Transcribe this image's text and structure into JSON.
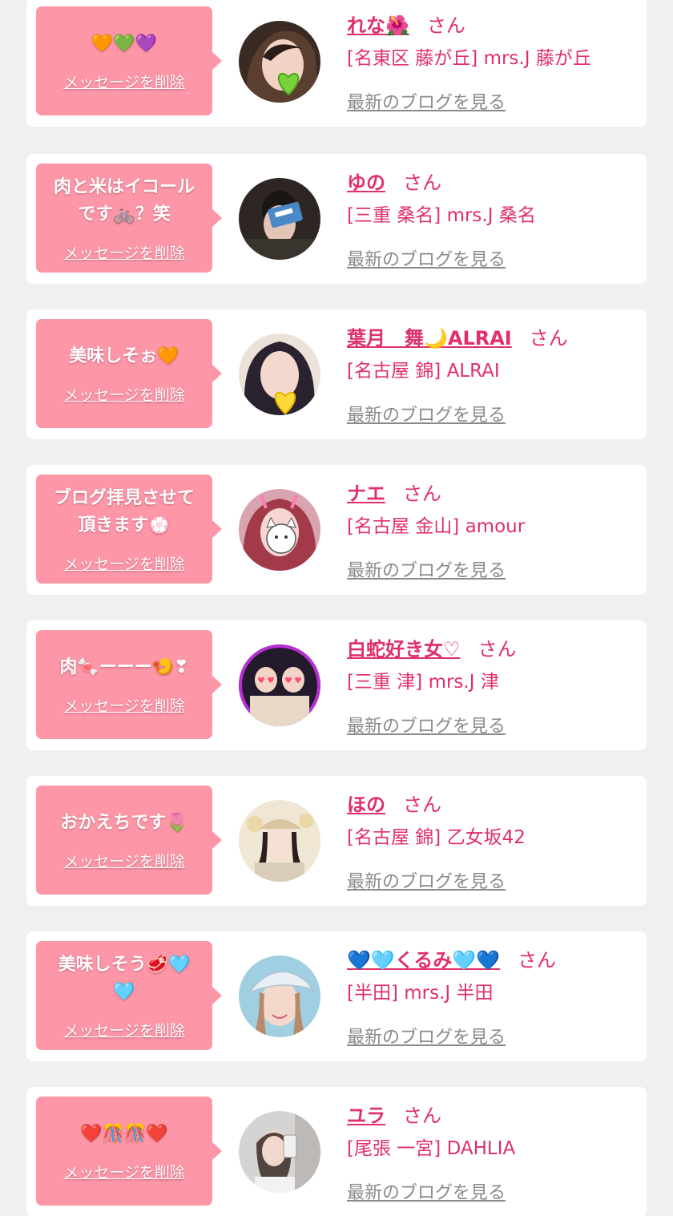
{
  "common": {
    "delete_label": "メッセージを削除",
    "san_suffix": "さん",
    "blog_link_label": "最新のブログを見る"
  },
  "colors": {
    "page_bg": "#f0f0f0",
    "card_bg": "#ffffff",
    "bubble_bg": "#fd97a8",
    "accent_pink": "#e0306a",
    "link_gray": "#8a8a8a"
  },
  "messages": [
    {
      "message": "🧡💚💜",
      "name": "れな🌺",
      "shop": "[名東区 藤が丘] mrs.J 藤が丘",
      "avatar_icon": "green-heart-sticker"
    },
    {
      "message": "肉と米はイコールです🚲？笑",
      "name": "ゆの",
      "shop": "[三重 桑名] mrs.J 桑名",
      "avatar_icon": "card-over-face"
    },
    {
      "message": "美味しそぉ🧡",
      "name": "葉月　舞🌙ALRAI",
      "shop": "[名古屋 錦] ALRAI",
      "avatar_icon": "yellow-heart-sticker"
    },
    {
      "message": "ブログ拝見させて頂きます💮",
      "name": "ナエ",
      "shop": "[名古屋 金山] amour",
      "avatar_icon": "cat-face-sticker"
    },
    {
      "message": "肉🍬ーーー🍤❣",
      "name": "白蛇好き女♡",
      "shop": "[三重 津] mrs.J 津",
      "avatar_icon": "heart-eyes-sticker"
    },
    {
      "message": "おかえちです🌷",
      "name": "ほの",
      "shop": "[名古屋 錦] 乙女坂42",
      "avatar_icon": "hat-photo"
    },
    {
      "message": "美味しそう🥩🩵🩵",
      "name": "💙🩵くるみ🩵💙",
      "shop": "[半田] mrs.J 半田",
      "avatar_icon": "cap-photo"
    },
    {
      "message": "❤️🎊🎊❤️",
      "name": "ユラ",
      "shop": "[尾張 一宮] DAHLIA",
      "avatar_icon": "mirror-selfie-photo"
    }
  ]
}
